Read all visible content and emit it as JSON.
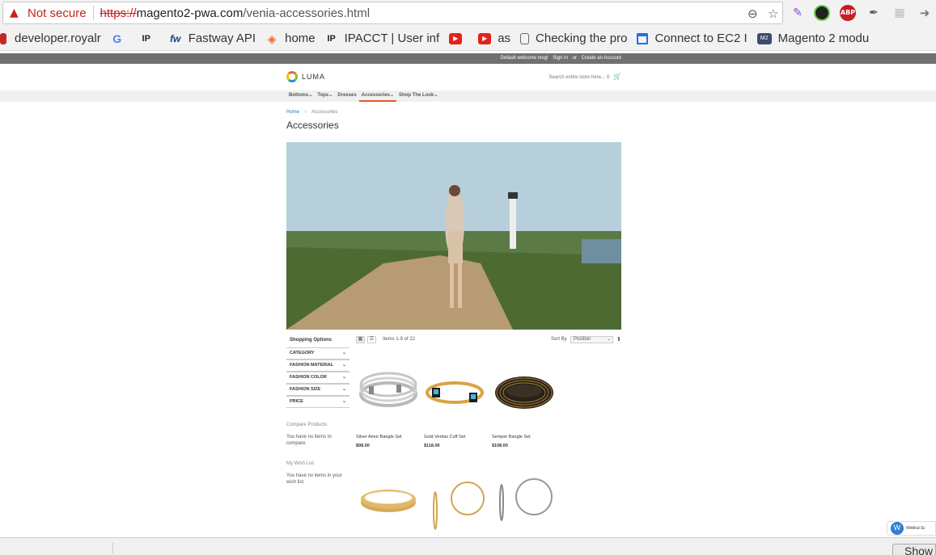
{
  "browser": {
    "security_label": "Not secure",
    "url_scheme": "https://",
    "url_host": "magento2-pwa.com",
    "url_path": "/venia-accessories.html",
    "extension_abp": "ABP",
    "bookmarks": [
      {
        "label": "developer.royalr",
        "icon": "red-box-icon"
      },
      {
        "label": "",
        "icon": "google-icon"
      },
      {
        "label": "",
        "icon": "ipacct-icon"
      },
      {
        "label": "Fastway API",
        "icon": "fastway-icon"
      },
      {
        "label": "home",
        "icon": "magento-icon"
      },
      {
        "label": "IPACCT | User inf",
        "icon": "ipacct-icon"
      },
      {
        "label": "",
        "icon": "youtube-icon"
      },
      {
        "label": "as",
        "icon": "youtube-icon"
      },
      {
        "label": "Checking the pro",
        "icon": "document-icon"
      },
      {
        "label": "Connect to EC2 I",
        "icon": "window-icon"
      },
      {
        "label": "Magento 2 modu",
        "icon": "m2-icon"
      }
    ]
  },
  "site": {
    "welcome": "Default welcome msg!",
    "sign_in": "Sign In",
    "or": "or",
    "create_account": "Create an Account",
    "logo": "LUMA",
    "search_placeholder": "Search entire store here...",
    "nav": [
      {
        "label": "Bottoms",
        "caret": true,
        "active": false
      },
      {
        "label": "Tops",
        "caret": true,
        "active": false
      },
      {
        "label": "Dresses",
        "caret": false,
        "active": false
      },
      {
        "label": "Accessories",
        "caret": true,
        "active": true
      },
      {
        "label": "Shop The Look",
        "caret": true,
        "active": false
      }
    ],
    "breadcrumb_home": "Home",
    "breadcrumb_current": "Accessories",
    "page_title": "Accessories"
  },
  "sidebar": {
    "title": "Shopping Options",
    "filters": [
      "CATEGORY",
      "FASHION MATERIAL",
      "FASHION COLOR",
      "FASHION SIZE",
      "PRICE"
    ],
    "compare_title": "Compare Products",
    "compare_text": "You have no items to compare.",
    "wishlist_title": "My Wish List",
    "wishlist_text": "You have no items in your wish list."
  },
  "toolbar": {
    "amount": "Items 1-9 of 22",
    "sort_label": "Sort By",
    "sort_value": "Position"
  },
  "products": [
    {
      "name": "Silver Amor Bangle Set",
      "price": "$98.00"
    },
    {
      "name": "Gold Veritas Cuff Set",
      "price": "$118.00"
    },
    {
      "name": "Semper Bangle Set",
      "price": "$108.00"
    }
  ],
  "widget": {
    "label": "Webkul Sc"
  },
  "statusbar": {
    "show_button": "Show"
  }
}
